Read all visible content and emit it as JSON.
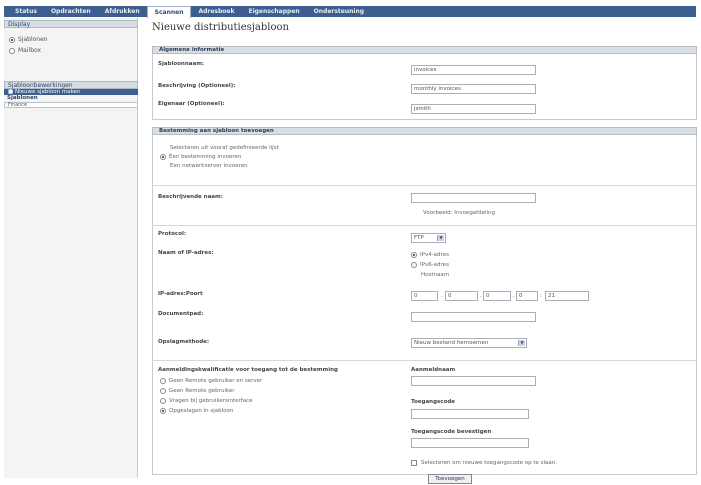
{
  "nav": {
    "tabs": [
      "Status",
      "Opdrachten",
      "Afdrukken",
      "Scannen",
      "Adresboek",
      "Eigenschappen",
      "Ondersteuning"
    ],
    "active_index": 3
  },
  "sidebar": {
    "display_heading": "Display",
    "display_options": [
      "Sjablonen",
      "Mailbox"
    ],
    "display_selected": 0,
    "tasks_heading": "Sjabloonbewerkingen",
    "task_active": "Nieuwe sjabloon maken",
    "templates_heading": "Sjablonen",
    "template_list": [
      "Finance"
    ]
  },
  "page_title": "Nieuwe distributiesjabloon",
  "general": {
    "heading": "Algemene informatie",
    "name_label": "Sjabloonnaam:",
    "name_value": "invoices",
    "desc_label": "Beschrijving (Optioneel):",
    "desc_value": "monthly invoices",
    "owner_label": "Eigenaar (Optioneel):",
    "owner_value": "jsmith"
  },
  "destination": {
    "heading": "Bestemming aan sjabloon toevoegen",
    "options": [
      "Selecteren uit vooraf gedefinieerde lijst",
      "Een bestemming invoeren",
      "Een netwerkserver invoeren"
    ],
    "selected": 1,
    "friendly_label": "Beschrijvende naam:",
    "friendly_value": "",
    "friendly_hint": "Voorbeeld: Invoegafdeling",
    "protocol_label": "Protocol:",
    "protocol_value": "FTP",
    "addr_label": "Naam of IP-adres:",
    "addr_options": [
      "IPv4-adres",
      "IPv6-adres",
      "Hostnaam"
    ],
    "addr_selected": 0,
    "ip_label": "IP-adres:Poort",
    "ip_parts": [
      "0",
      "0",
      "0",
      "0"
    ],
    "port": "21",
    "path_label": "Documentpad:",
    "path_value": "",
    "naming_label": "Opslagmethode:",
    "naming_value": "Nieuw bestand hernoemen",
    "auth_label": "Aanmeldingskwalificatie voor toegang tot de bestemming",
    "auth_options": [
      "Geen Remote gebruiker en server",
      "Geen Remote gebruiker",
      "Vragen bij gebruikersinterface",
      "Opgeslagen in sjabloon"
    ],
    "auth_selected": 3,
    "login_label": "Aanmeldnaam",
    "login_value": "",
    "password_label": "Toegangscode",
    "password_value": "",
    "confirm_label": "Toegangscode bevestigen",
    "confirm_value": "",
    "checkbox_label": "Selecteren om nieuwe toegangscode op te slaan.",
    "checkbox_checked": false,
    "add_button": "Toevoegen"
  }
}
